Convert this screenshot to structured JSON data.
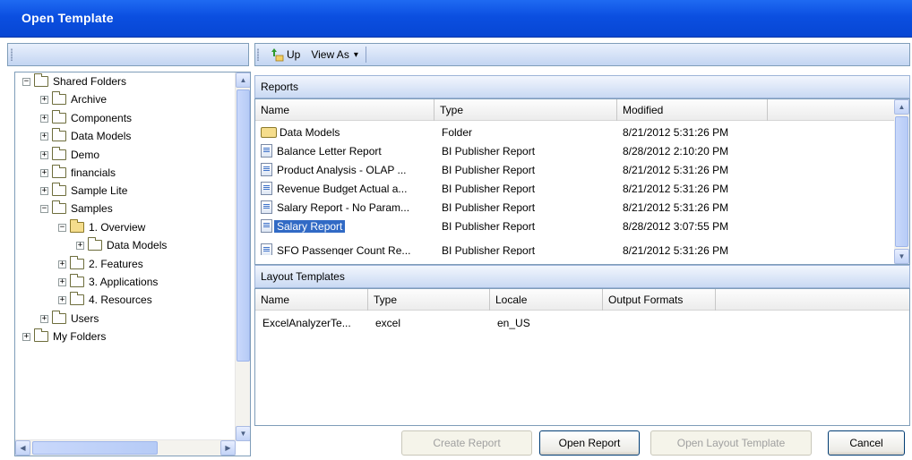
{
  "window": {
    "title": "Open Template"
  },
  "tree": {
    "items": [
      {
        "label": "Shared Folders",
        "expander": "−",
        "open": false
      },
      {
        "label": "Archive",
        "expander": "+"
      },
      {
        "label": "Components",
        "expander": "+"
      },
      {
        "label": "Data Models",
        "expander": "+"
      },
      {
        "label": "Demo",
        "expander": "+"
      },
      {
        "label": "financials",
        "expander": "+"
      },
      {
        "label": "Sample Lite",
        "expander": "+"
      },
      {
        "label": "Samples",
        "expander": "−"
      },
      {
        "label": "1. Overview",
        "expander": "−",
        "open": true
      },
      {
        "label": "Data Models",
        "expander": "+"
      },
      {
        "label": "2. Features",
        "expander": "+"
      },
      {
        "label": "3. Applications",
        "expander": "+"
      },
      {
        "label": "4. Resources",
        "expander": "+"
      },
      {
        "label": "Users",
        "expander": "+"
      },
      {
        "label": "My Folders",
        "expander": "+"
      }
    ]
  },
  "toolbar": {
    "up_label": "Up",
    "view_as_label": "View As",
    "view_as_arrow": "▾"
  },
  "reports": {
    "section_title": "Reports",
    "columns": [
      "Name",
      "Type",
      "Modified"
    ],
    "rows": [
      {
        "name": "Data Models",
        "type": "Folder",
        "modified": "8/21/2012 5:31:26 PM",
        "icon": "folder-icon"
      },
      {
        "name": "Balance Letter Report",
        "type": "BI Publisher Report",
        "modified": "8/28/2012 2:10:20 PM",
        "icon": "report-icon"
      },
      {
        "name": "Product Analysis - OLAP ...",
        "type": "BI Publisher Report",
        "modified": "8/21/2012 5:31:26 PM",
        "icon": "report-icon"
      },
      {
        "name": "Revenue Budget Actual a...",
        "type": "BI Publisher Report",
        "modified": "8/21/2012 5:31:26 PM",
        "icon": "report-icon"
      },
      {
        "name": "Salary Report - No Param...",
        "type": "BI Publisher Report",
        "modified": "8/21/2012 5:31:26 PM",
        "icon": "report-icon"
      },
      {
        "name": "Salary Report",
        "type": "BI Publisher Report",
        "modified": "8/28/2012 3:07:55 PM",
        "icon": "report-icon",
        "selected": true
      },
      {
        "name": "SFO Passenger Count Re...",
        "type": "BI Publisher Report",
        "modified": "8/21/2012 5:31:26 PM",
        "icon": "report-icon"
      }
    ]
  },
  "layout_templates": {
    "section_title": "Layout Templates",
    "columns": [
      "Name",
      "Type",
      "Locale",
      "Output Formats"
    ],
    "rows": [
      {
        "name": "ExcelAnalyzerTe...",
        "type": "excel",
        "locale": "en_US",
        "output_formats": ""
      }
    ]
  },
  "buttons": {
    "create_report": "Create Report",
    "open_report": "Open Report",
    "open_layout_template": "Open Layout Template",
    "cancel": "Cancel"
  },
  "scroll_glyphs": {
    "up": "▲",
    "down": "▼",
    "left": "◀",
    "right": "▶"
  }
}
